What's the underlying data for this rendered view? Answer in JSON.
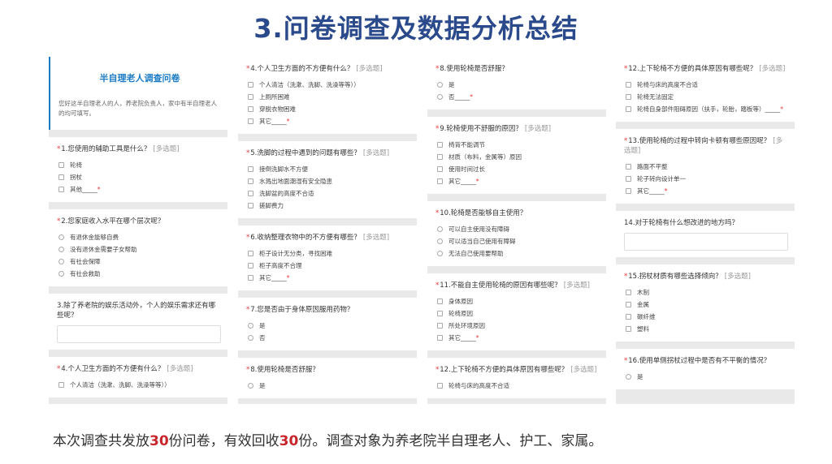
{
  "title": "3.问卷调查及数据分析总结",
  "survey": {
    "title": "半自理老人调查问卷",
    "desc": "您好这半自理老人的人，养老院负责人，家中有半自理老人的均可填写。"
  },
  "columns": [
    [
      {
        "q": "1.您使用的辅助工具是什么？",
        "tag": "[多选题]",
        "req": true,
        "type": "check",
        "opts": [
          {
            "t": "轮椅"
          },
          {
            "t": "拐杖"
          },
          {
            "t": "其他_____",
            "star": true
          }
        ]
      },
      {
        "q": "2.您家庭收入水平在哪个层次呢？",
        "tag": "",
        "req": true,
        "type": "radio",
        "opts": [
          {
            "t": "有退休金能够自费"
          },
          {
            "t": "没有退休金需要子女帮助"
          },
          {
            "t": "有社会保障"
          },
          {
            "t": "有社会救助"
          }
        ]
      },
      {
        "q": "3.除了养老院的娱乐活动外，个人的娱乐需求还有哪些呢？",
        "tag": "",
        "req": false,
        "type": "text",
        "opts": []
      },
      {
        "q": "4.个人卫生方面的不方便有什么？",
        "tag": "[多选题]",
        "req": true,
        "type": "check",
        "opts": [
          {
            "t": "个人清洁（洗漱、洗脚、洗澡等等））"
          }
        ]
      }
    ],
    [
      {
        "q": "4.个人卫生方面的不方便有什么？",
        "tag": "[多选题]",
        "req": true,
        "type": "check",
        "opts": [
          {
            "t": "个人清洁（洗漱、洗脚、洗澡等等））"
          },
          {
            "t": "上厕所困难"
          },
          {
            "t": "穿脱衣物困难"
          },
          {
            "t": "其它_____",
            "star": true
          }
        ]
      },
      {
        "q": "5.洗脚的过程中遇到的问题有哪些？",
        "tag": "[多选题]",
        "req": true,
        "type": "check",
        "opts": [
          {
            "t": "接倒洗脚水不方便"
          },
          {
            "t": "水溅出地面潮湿有安全隐患"
          },
          {
            "t": "洗脚盆的高度不合适"
          },
          {
            "t": "搓脚费力"
          }
        ]
      },
      {
        "q": "6.收纳整理衣物中的不方便有哪些？",
        "tag": "[多选题]",
        "req": true,
        "type": "check",
        "opts": [
          {
            "t": "柜子设计无分类，寻找困难"
          },
          {
            "t": "柜子高度不合理"
          },
          {
            "t": "其它_____",
            "star": true
          }
        ]
      },
      {
        "q": "7.您是否由于身体原因服用药物？",
        "tag": "",
        "req": true,
        "type": "radio",
        "opts": [
          {
            "t": "是"
          },
          {
            "t": "否"
          }
        ]
      },
      {
        "q": "8.使用轮椅是否舒服？",
        "tag": "",
        "req": true,
        "type": "radio",
        "opts": [
          {
            "t": "是"
          }
        ]
      }
    ],
    [
      {
        "q": "8.使用轮椅是否舒服？",
        "tag": "",
        "req": true,
        "type": "radio",
        "opts": [
          {
            "t": "是"
          },
          {
            "t": "否_____",
            "star": true
          }
        ]
      },
      {
        "q": "9.轮椅使用不舒服的原因？",
        "tag": "[多选题]",
        "req": true,
        "type": "check",
        "opts": [
          {
            "t": "椅背不能调节"
          },
          {
            "t": "材质（布料，金属等）原因"
          },
          {
            "t": "使用时间过长"
          },
          {
            "t": "其它_____",
            "star": true
          }
        ]
      },
      {
        "q": "10.轮椅是否能够自主使用？",
        "tag": "",
        "req": true,
        "type": "radio",
        "opts": [
          {
            "t": "可以自主使用没有障碍"
          },
          {
            "t": "可以适当自己使用有障碍"
          },
          {
            "t": "无法自己使用要帮助"
          }
        ]
      },
      {
        "q": "11.不能自主使用轮椅的原因有哪些呢？",
        "tag": "[多选题]",
        "req": true,
        "type": "check",
        "opts": [
          {
            "t": "身体原因"
          },
          {
            "t": "轮椅原因"
          },
          {
            "t": "所处环境原因"
          },
          {
            "t": "其它_____",
            "star": true
          }
        ]
      },
      {
        "q": "12.上下轮椅不方便的具体原因有哪些呢？",
        "tag": "[多选题]",
        "req": true,
        "type": "check",
        "opts": [
          {
            "t": "轮椅与床的高度不合适"
          }
        ]
      }
    ],
    [
      {
        "q": "12.上下轮椅不方便的具体原因有哪些呢？",
        "tag": "[多选题]",
        "req": true,
        "type": "check",
        "opts": [
          {
            "t": "轮椅与床的高度不合适"
          },
          {
            "t": "轮椅无法固定"
          },
          {
            "t": "轮椅自身部件阻碍原因（扶手，轮胎，踏板等）_____",
            "star": true
          }
        ]
      },
      {
        "q": "13.使用轮椅的过程中转向卡顿有哪些原因呢？",
        "tag": "[多选题]",
        "req": true,
        "type": "check",
        "opts": [
          {
            "t": "路面不平整"
          },
          {
            "t": "轮子转向设计单一"
          },
          {
            "t": "其它_____",
            "star": true
          }
        ]
      },
      {
        "q": "14.对于轮椅有什么想改进的地方吗？",
        "tag": "",
        "req": false,
        "type": "text",
        "opts": []
      },
      {
        "q": "15.拐杖材质有哪些选择倾向？",
        "tag": "[多选题]",
        "req": true,
        "type": "check",
        "opts": [
          {
            "t": "木制"
          },
          {
            "t": "金属"
          },
          {
            "t": "碳纤维"
          },
          {
            "t": "塑料"
          }
        ]
      },
      {
        "q": "16.使用单侧拐杖过程中是否有不平衡的情况？",
        "tag": "",
        "req": true,
        "type": "radio",
        "opts": [
          {
            "t": "是"
          }
        ]
      }
    ]
  ],
  "bottom": {
    "pre": "本次调查共发放",
    "n1": "30",
    "mid": "份问卷，有效回收",
    "n2": "30",
    "post": "份。调查对象为养老院半自理老人、护工、家属。"
  }
}
